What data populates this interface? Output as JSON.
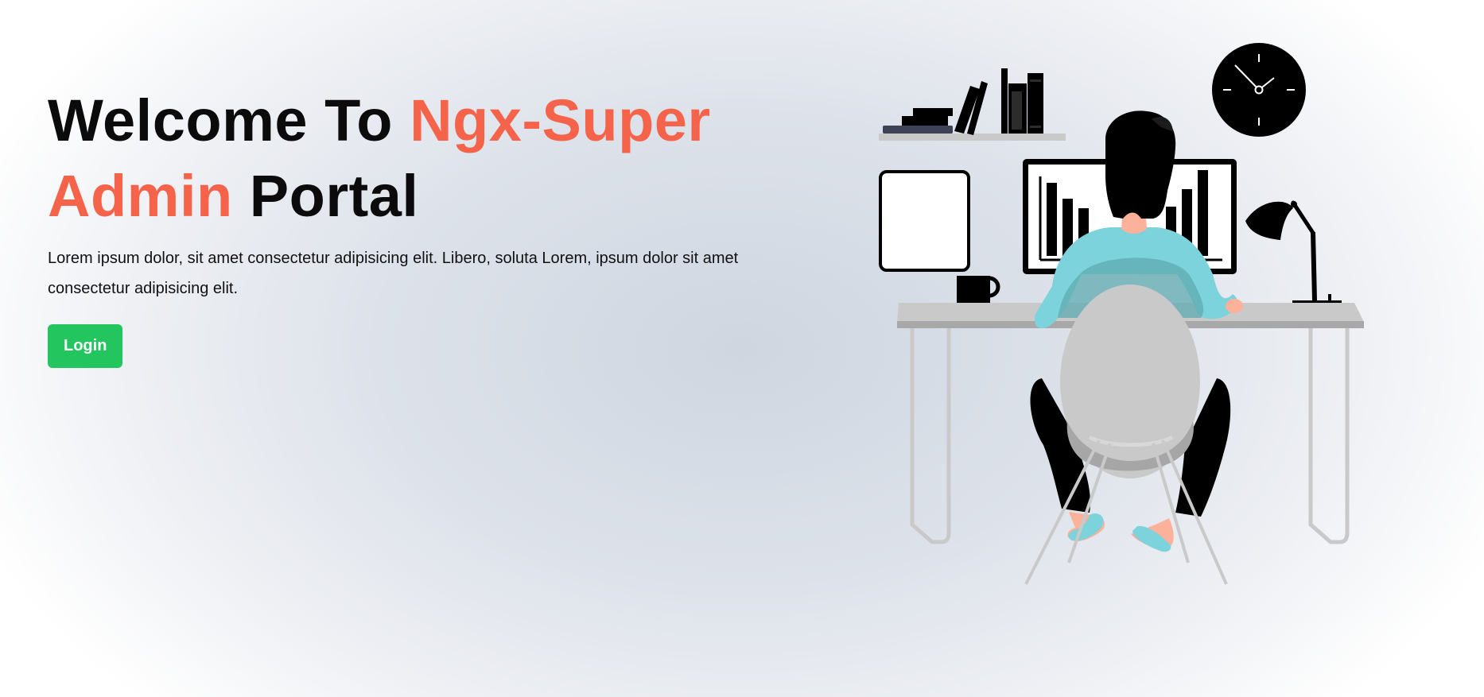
{
  "hero": {
    "title_part1": "Welcome To ",
    "title_highlight1": "Ngx-Super",
    "title_highlight2": "Admin",
    "title_part2": " Portal",
    "description": "Lorem ipsum dolor, sit amet consectetur adipisicing elit. Libero, soluta Lorem, ipsum dolor sit amet consectetur adipisicing elit.",
    "login_label": "Login"
  },
  "colors": {
    "accent": "#f5634a",
    "login_button": "#22c55e",
    "shirt": "#7dd3dc"
  }
}
